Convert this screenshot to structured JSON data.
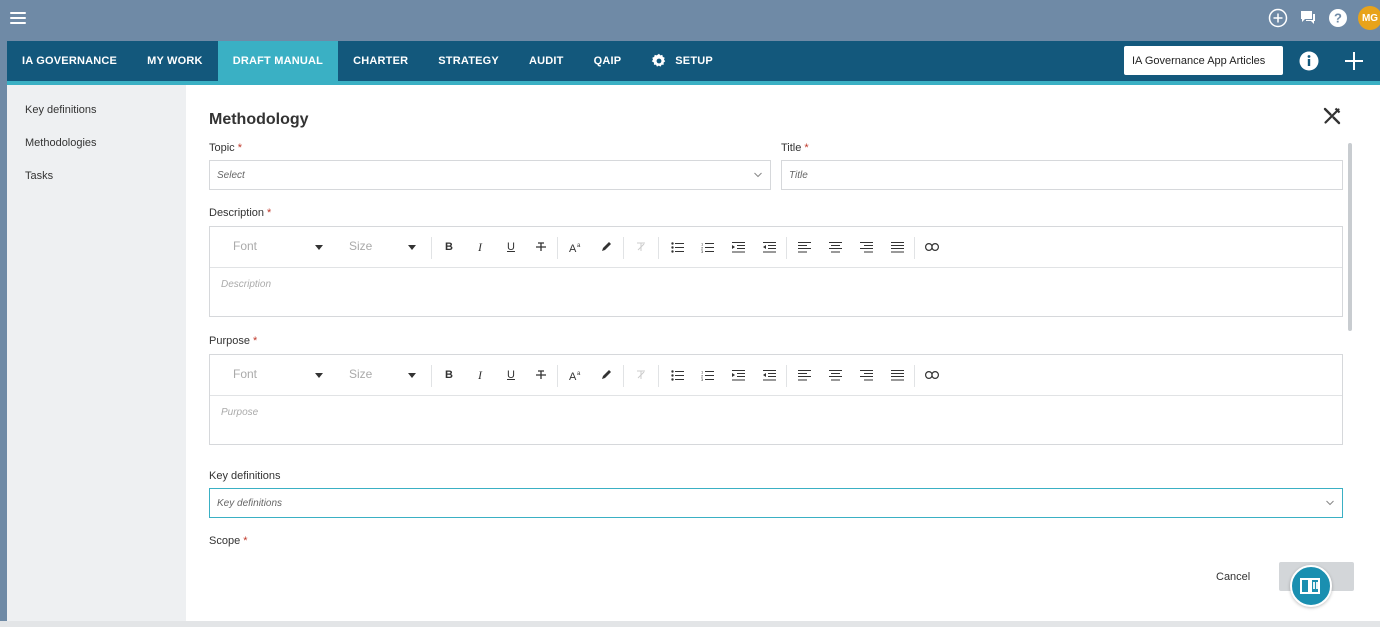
{
  "topbar": {
    "avatar_initials": "MG",
    "icons": [
      "menu-icon",
      "add-circle-icon",
      "chat-icon",
      "help-icon"
    ]
  },
  "nav": {
    "items": [
      {
        "label": "IA GOVERNANCE",
        "active": false
      },
      {
        "label": "MY WORK",
        "active": false
      },
      {
        "label": "DRAFT MANUAL",
        "active": true
      },
      {
        "label": "CHARTER",
        "active": false
      },
      {
        "label": "STRATEGY",
        "active": false
      },
      {
        "label": "AUDIT",
        "active": false
      },
      {
        "label": "QAIP",
        "active": false
      },
      {
        "label": "SETUP",
        "active": false,
        "icon": "gear-icon"
      }
    ],
    "app_select": "IA Governance App Articles"
  },
  "sidebar": {
    "items": [
      {
        "label": "Key definitions"
      },
      {
        "label": "Methodologies"
      },
      {
        "label": "Tasks"
      }
    ]
  },
  "form": {
    "title": "Methodology",
    "topic": {
      "label": "Topic",
      "required": "*",
      "placeholder": "Select"
    },
    "title_field": {
      "label": "Title",
      "required": "*",
      "placeholder": "Title"
    },
    "description": {
      "label": "Description",
      "required": "*",
      "placeholder": "Description"
    },
    "purpose": {
      "label": "Purpose",
      "required": "*",
      "placeholder": "Purpose"
    },
    "key_definitions": {
      "label": "Key definitions",
      "placeholder": "Key definitions"
    },
    "scope": {
      "label": "Scope",
      "required": "*"
    },
    "toolbar": {
      "font": "Font",
      "size": "Size",
      "bold": "B",
      "italic": "I",
      "underline": "U"
    },
    "cancel": "Cancel"
  },
  "colors": {
    "topbar": "#6f8aa6",
    "navbar": "#13587c",
    "accent": "#3ab0c4",
    "avatar": "#e8a31a",
    "required": "#c0392b"
  }
}
